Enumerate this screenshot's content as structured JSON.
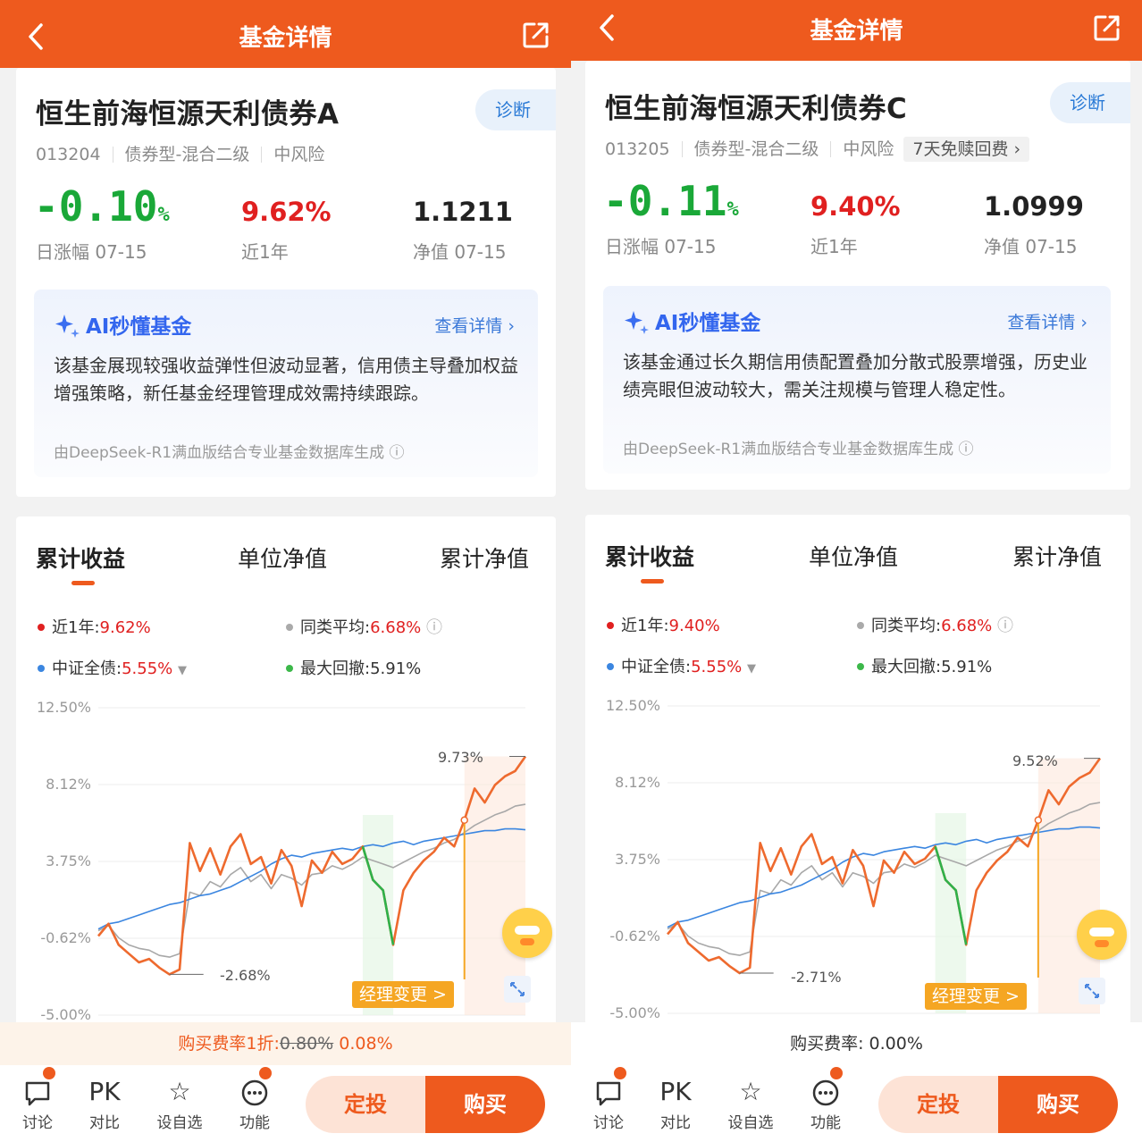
{
  "colors": {
    "brand": "#ee5a1e",
    "up": "#e02020",
    "down": "#1aa838",
    "fund": "#ee6a2e",
    "benchmark": "#3b86e0",
    "category": "#999999",
    "drawdown": "#1aa838"
  },
  "panels": [
    {
      "header": {
        "title": "基金详情",
        "back_icon": "chevron-left-icon",
        "share_icon": "share-icon"
      },
      "fund": {
        "name": "恒生前海恒源天利债券A",
        "diagnose": "诊断",
        "code": "013204",
        "type": "债券型-混合二级",
        "risk": "中风险",
        "tag": ""
      },
      "stats": {
        "daily_num": "-0.10",
        "daily_unit": "%",
        "daily_label": "日涨幅 07-15",
        "year_value": "9.62%",
        "year_label": "近1年",
        "nav_value": "1.1211",
        "nav_label": "净值 07-15"
      },
      "ai": {
        "title": "AI秒懂基金",
        "more": "查看详情",
        "text": "该基金展现较强收益弹性但波动显著，信用债主导叠加权益增强策略，新任基金经理管理成效需持续跟踪。",
        "footer": "由DeepSeek-R1满血版结合专业基金数据库生成"
      },
      "tabs": [
        "累计收益",
        "单位净值",
        "累计净值"
      ],
      "legend": {
        "year_label": "近1年:",
        "year_value": "9.62%",
        "avg_label": "同类平均:",
        "avg_value": "6.68%",
        "bench_label": "中证全债:",
        "bench_value": "5.55%",
        "dd_label": "最大回撤:",
        "dd_value": "5.91%"
      },
      "chart_data": {
        "type": "line",
        "y_ticks": [
          "12.50%",
          "8.12%",
          "3.75%",
          "-0.62%",
          "-5.00%"
        ],
        "ylim": [
          -5.0,
          12.5
        ],
        "max_label": "9.73%",
        "min_label": "-2.68%",
        "manager_change": "经理变更 >",
        "series": [
          {
            "name": "近1年",
            "values": [
              -0.5,
              0.2,
              -1.0,
              -1.5,
              -2.0,
              -1.8,
              -2.3,
              -2.68,
              -2.4,
              4.8,
              3.2,
              4.5,
              3.0,
              4.6,
              5.3,
              3.6,
              4.0,
              2.5,
              4.4,
              3.5,
              1.2,
              3.8,
              3.1,
              4.3,
              3.6,
              3.9,
              4.6,
              2.7,
              2.1,
              -1.0,
              2.1,
              3.1,
              3.8,
              4.3,
              5.1,
              4.6,
              6.1,
              7.9,
              7.1,
              8.1,
              8.6,
              8.9,
              9.73
            ]
          },
          {
            "name": "同类平均",
            "values": [
              -0.2,
              0.1,
              -0.6,
              -1.0,
              -1.2,
              -1.3,
              -1.6,
              -1.7,
              -1.5,
              2.0,
              1.8,
              2.6,
              2.3,
              3.0,
              3.4,
              2.6,
              3.0,
              2.2,
              3.0,
              2.8,
              2.4,
              3.0,
              3.1,
              3.5,
              3.3,
              3.6,
              4.0,
              3.8,
              3.6,
              3.4,
              3.7,
              4.0,
              4.3,
              4.5,
              4.8,
              5.0,
              5.4,
              5.8,
              6.1,
              6.4,
              6.6,
              6.9,
              7.0
            ]
          },
          {
            "name": "中证全债",
            "values": [
              -0.1,
              0.2,
              0.3,
              0.5,
              0.7,
              0.9,
              1.1,
              1.3,
              1.4,
              1.6,
              1.8,
              1.9,
              2.1,
              2.3,
              2.6,
              2.9,
              3.2,
              3.6,
              3.9,
              4.1,
              4.0,
              4.2,
              4.3,
              4.4,
              4.5,
              4.4,
              4.6,
              4.7,
              4.6,
              4.8,
              4.9,
              4.7,
              4.9,
              5.0,
              5.1,
              5.2,
              5.3,
              5.4,
              5.5,
              5.5,
              5.6,
              5.6,
              5.55
            ]
          }
        ]
      },
      "fee": {
        "prefix": "购买费率1折:",
        "old": "0.80%",
        "new": "0.08%"
      },
      "bottom": {
        "discuss": "讨论",
        "pk_icon": "PK",
        "pk": "对比",
        "watch": "设自选",
        "func": "功能",
        "invest": "定投",
        "buy": "购买"
      }
    },
    {
      "header": {
        "title": "基金详情",
        "back_icon": "chevron-left-icon",
        "share_icon": "share-icon"
      },
      "fund": {
        "name": "恒生前海恒源天利债券C",
        "diagnose": "诊断",
        "code": "013205",
        "type": "债券型-混合二级",
        "risk": "中风险",
        "tag": "7天免赎回费 ›"
      },
      "stats": {
        "daily_num": "-0.11",
        "daily_unit": "%",
        "daily_label": "日涨幅 07-15",
        "year_value": "9.40%",
        "year_label": "近1年",
        "nav_value": "1.0999",
        "nav_label": "净值 07-15"
      },
      "ai": {
        "title": "AI秒懂基金",
        "more": "查看详情",
        "text": "该基金通过长久期信用债配置叠加分散式股票增强，历史业绩亮眼但波动较大，需关注规模与管理人稳定性。",
        "footer": "由DeepSeek-R1满血版结合专业基金数据库生成"
      },
      "tabs": [
        "累计收益",
        "单位净值",
        "累计净值"
      ],
      "legend": {
        "year_label": "近1年:",
        "year_value": "9.40%",
        "avg_label": "同类平均:",
        "avg_value": "6.68%",
        "bench_label": "中证全债:",
        "bench_value": "5.55%",
        "dd_label": "最大回撤:",
        "dd_value": "5.91%"
      },
      "chart_data": {
        "type": "line",
        "y_ticks": [
          "12.50%",
          "8.12%",
          "3.75%",
          "-0.62%",
          "-5.00%"
        ],
        "ylim": [
          -5.0,
          12.5
        ],
        "max_label": "9.52%",
        "min_label": "-2.71%",
        "manager_change": "经理变更 >",
        "series": [
          {
            "name": "近1年",
            "values": [
              -0.5,
              0.2,
              -1.0,
              -1.5,
              -2.0,
              -1.8,
              -2.3,
              -2.71,
              -2.4,
              4.7,
              3.1,
              4.4,
              2.9,
              4.5,
              5.2,
              3.5,
              3.9,
              2.4,
              4.3,
              3.4,
              1.1,
              3.7,
              3.0,
              4.2,
              3.5,
              3.8,
              4.5,
              2.6,
              2.0,
              -1.1,
              2.0,
              3.0,
              3.7,
              4.2,
              5.0,
              4.5,
              6.0,
              7.7,
              6.9,
              7.9,
              8.4,
              8.7,
              9.52
            ]
          },
          {
            "name": "同类平均",
            "values": [
              -0.2,
              0.1,
              -0.6,
              -1.0,
              -1.2,
              -1.3,
              -1.6,
              -1.7,
              -1.5,
              2.0,
              1.8,
              2.6,
              2.3,
              3.0,
              3.4,
              2.6,
              3.0,
              2.2,
              3.0,
              2.8,
              2.4,
              3.0,
              3.1,
              3.5,
              3.3,
              3.6,
              4.0,
              3.8,
              3.6,
              3.4,
              3.7,
              4.0,
              4.3,
              4.5,
              4.8,
              5.0,
              5.4,
              5.8,
              6.1,
              6.4,
              6.6,
              6.9,
              7.0
            ]
          },
          {
            "name": "中证全债",
            "values": [
              -0.1,
              0.2,
              0.3,
              0.5,
              0.7,
              0.9,
              1.1,
              1.3,
              1.4,
              1.6,
              1.8,
              1.9,
              2.1,
              2.3,
              2.6,
              2.9,
              3.2,
              3.6,
              3.9,
              4.1,
              4.0,
              4.2,
              4.3,
              4.4,
              4.5,
              4.4,
              4.6,
              4.7,
              4.6,
              4.8,
              4.9,
              4.7,
              4.9,
              5.0,
              5.1,
              5.2,
              5.3,
              5.4,
              5.5,
              5.5,
              5.6,
              5.6,
              5.55
            ]
          }
        ]
      },
      "fee": {
        "prefix": "购买费率:",
        "old": "",
        "new": "0.00%"
      },
      "bottom": {
        "discuss": "讨论",
        "pk_icon": "PK",
        "pk": "对比",
        "watch": "设自选",
        "func": "功能",
        "invest": "定投",
        "buy": "购买"
      }
    }
  ]
}
